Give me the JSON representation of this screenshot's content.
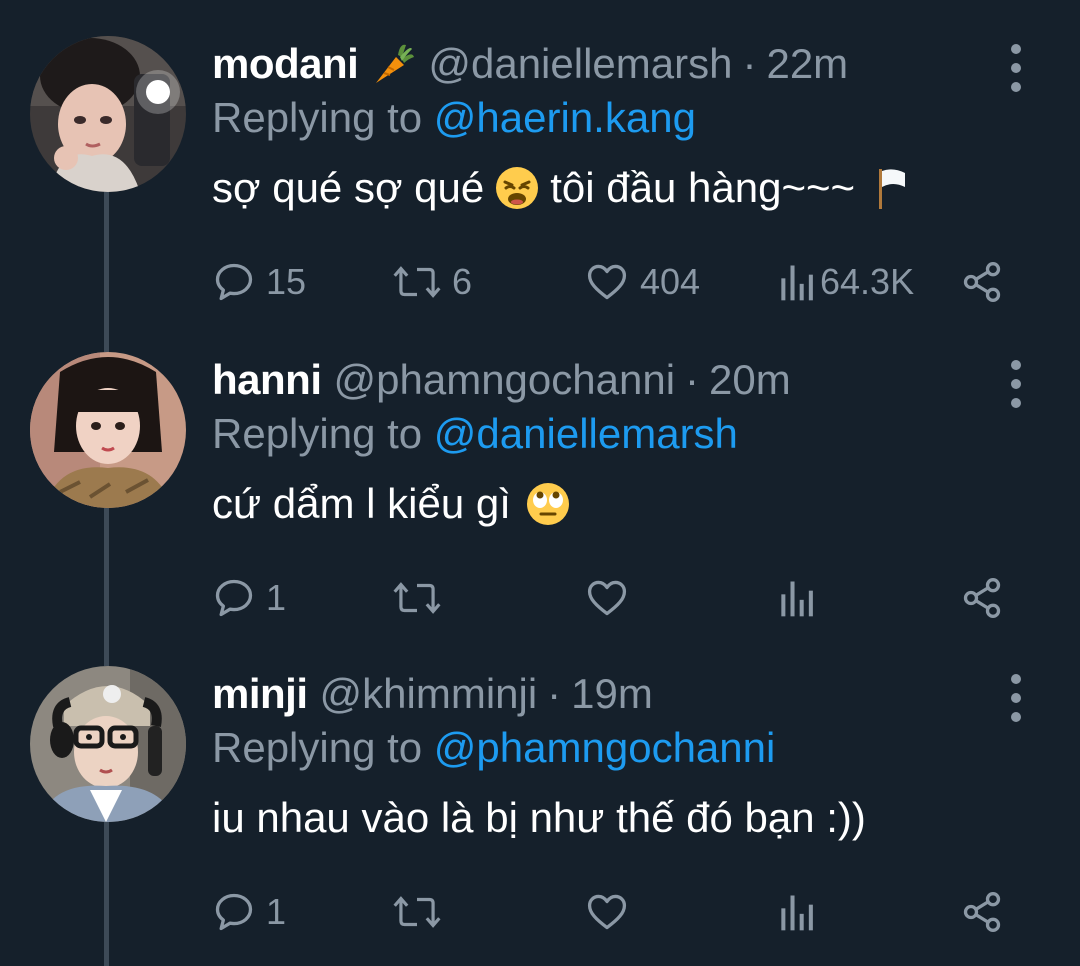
{
  "tweets": [
    {
      "display_name": "modani",
      "name_emoji": "carrot-icon",
      "handle": "@daniellemarsh",
      "separator": "·",
      "time": "22m",
      "replying_prefix": "Replying to",
      "replying_to": "@haerin.kang",
      "text_before_emoji": "sợ qué sợ qué",
      "text_emoji": "weary-face-emoji",
      "text_after_emoji": "tôi đầu hàng~~~",
      "text_trailing_emoji": "white-flag-emoji",
      "replies": "15",
      "retweets": "6",
      "likes": "404",
      "views": "64.3K"
    },
    {
      "display_name": "hanni",
      "handle": "@phamngochanni",
      "separator": "·",
      "time": "20m",
      "replying_prefix": "Replying to",
      "replying_to": "@daniellemarsh",
      "text_before_emoji": "cứ dẩm l kiểu gì",
      "text_emoji": "rolling-eyes-emoji",
      "replies": "1",
      "retweets": "",
      "likes": "",
      "views": ""
    },
    {
      "display_name": "minji",
      "handle": "@khimminji",
      "separator": "·",
      "time": "19m",
      "replying_prefix": "Replying to",
      "replying_to": "@phamngochanni",
      "text_before_emoji": "iu nhau vào là bị như thế đó bạn :))",
      "replies": "1",
      "retweets": "",
      "likes": "",
      "views": ""
    }
  ],
  "colors": {
    "background": "#15202b",
    "primary_text": "#ffffff",
    "secondary_text": "#8b98a5",
    "link": "#1d9bf0",
    "thread_line": "#3d4a57"
  }
}
